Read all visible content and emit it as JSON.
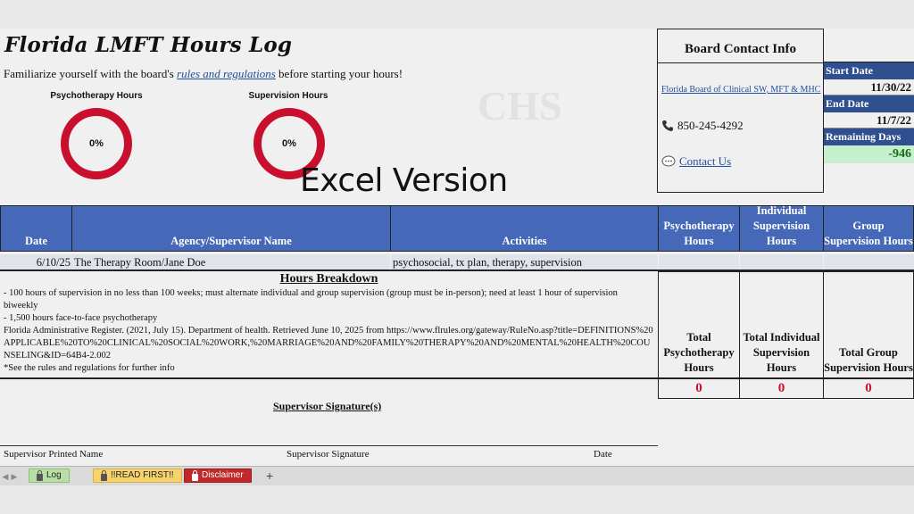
{
  "title": "Florida LMFT Hours Log",
  "intro": {
    "prefix": "Familiarize yourself with the board's ",
    "link": "rules and regulations",
    "suffix": " before starting your hours!"
  },
  "donuts": [
    {
      "label": "Psychotherapy Hours",
      "value": "0%"
    },
    {
      "label": "Supervision Hours",
      "value": "0%"
    }
  ],
  "overlay_text": "Excel Version",
  "board": {
    "title": "Board Contact Info",
    "link": "Florida Board of Clinical SW, MFT & MHC",
    "phone": "850-245-4292",
    "contact": "Contact Us"
  },
  "dates": {
    "start_label": "Start Date",
    "start_value": "11/30/22",
    "end_label": "End Date",
    "end_value": "11/7/22",
    "remaining_label": "Remaining Days",
    "remaining_value": "-946"
  },
  "table": {
    "headers": {
      "date": "Date",
      "agency": "Agency/Supervisor Name",
      "activities": "Activities",
      "psycho": "Psychotherapy Hours",
      "individual": "Individual Supervision Hours",
      "group": "Group Supervision Hours"
    },
    "row": {
      "date": "6/10/25",
      "agency": "The Therapy Room/Jane Doe",
      "activities": "psychosocial, tx plan, therapy, supervision"
    }
  },
  "breakdown": {
    "title": "Hours Breakdown",
    "lines": [
      "- 100 hours of supervision in no less than 100 weeks; must alternate individual and group supervision (group must be in-person); need at least 1 hour of supervision biweekly",
      "- 1,500 hours face-to-face psychotherapy",
      "Florida Administrative Register. (2021, July 15). Department of health. Retrieved June 10, 2025 from https://www.flrules.org/gateway/RuleNo.asp?title=DEFINITIONS%20APPLICABLE%20TO%20CLINICAL%20SOCIAL%20WORK,%20MARRIAGE%20AND%20FAMILY%20THERAPY%20AND%20MENTAL%20HEALTH%20COUNSELING&ID=64B4-2.002",
      "*See the rules and regulations for further info"
    ]
  },
  "totals": {
    "psycho_label": "Total Psychotherapy Hours",
    "individual_label": "Total Individual Supervision Hours",
    "group_label": "Total Group Supervision Hours",
    "psycho_value": "0",
    "individual_value": "0",
    "group_value": "0"
  },
  "signature": {
    "title": "Supervisor Signature(s)",
    "printed_name": "Supervisor Printed Name",
    "signature": "Supervisor Signature",
    "date": "Date"
  },
  "tabs": [
    {
      "label": "Log",
      "color": "#b9dfa6"
    },
    {
      "label": "!!READ FIRST!!",
      "color": "#f6d36b"
    },
    {
      "label": "Disclaimer",
      "color": "#c0282b"
    }
  ],
  "add_tab": "+",
  "colors": {
    "header_blue": "#4568b8",
    "label_navy": "#2f4f8f",
    "donut_red": "#c8102e",
    "remaining_green_bg": "#c6efce"
  }
}
